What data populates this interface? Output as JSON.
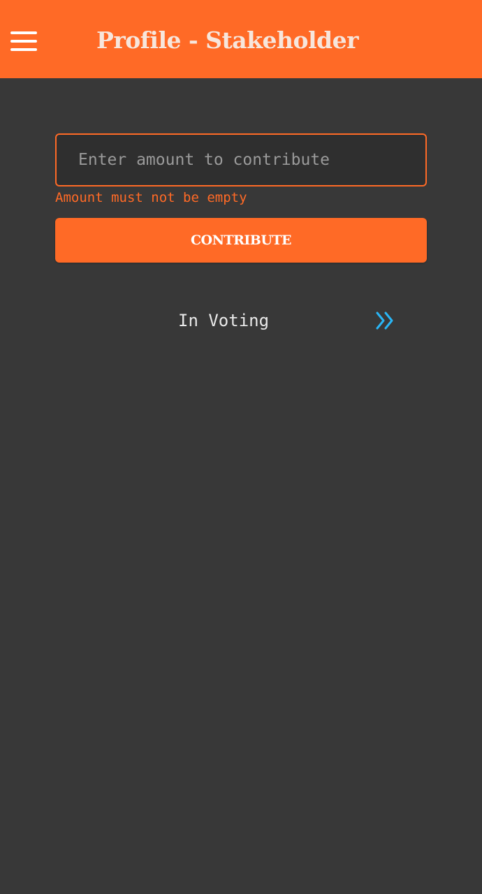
{
  "header": {
    "title": "Profile - Stakeholder",
    "menu_icon": "hamburger-menu-icon"
  },
  "contribute_form": {
    "amount_value": "",
    "amount_placeholder": "Enter amount to contribute",
    "error_message": "Amount must not be empty",
    "submit_label": "CONTRIBUTE"
  },
  "voting": {
    "label": "In Voting",
    "arrow_icon": "double-chevron-right-icon"
  },
  "colors": {
    "accent": "#ff6a26",
    "background": "#383838",
    "arrow": "#29b6f6"
  }
}
